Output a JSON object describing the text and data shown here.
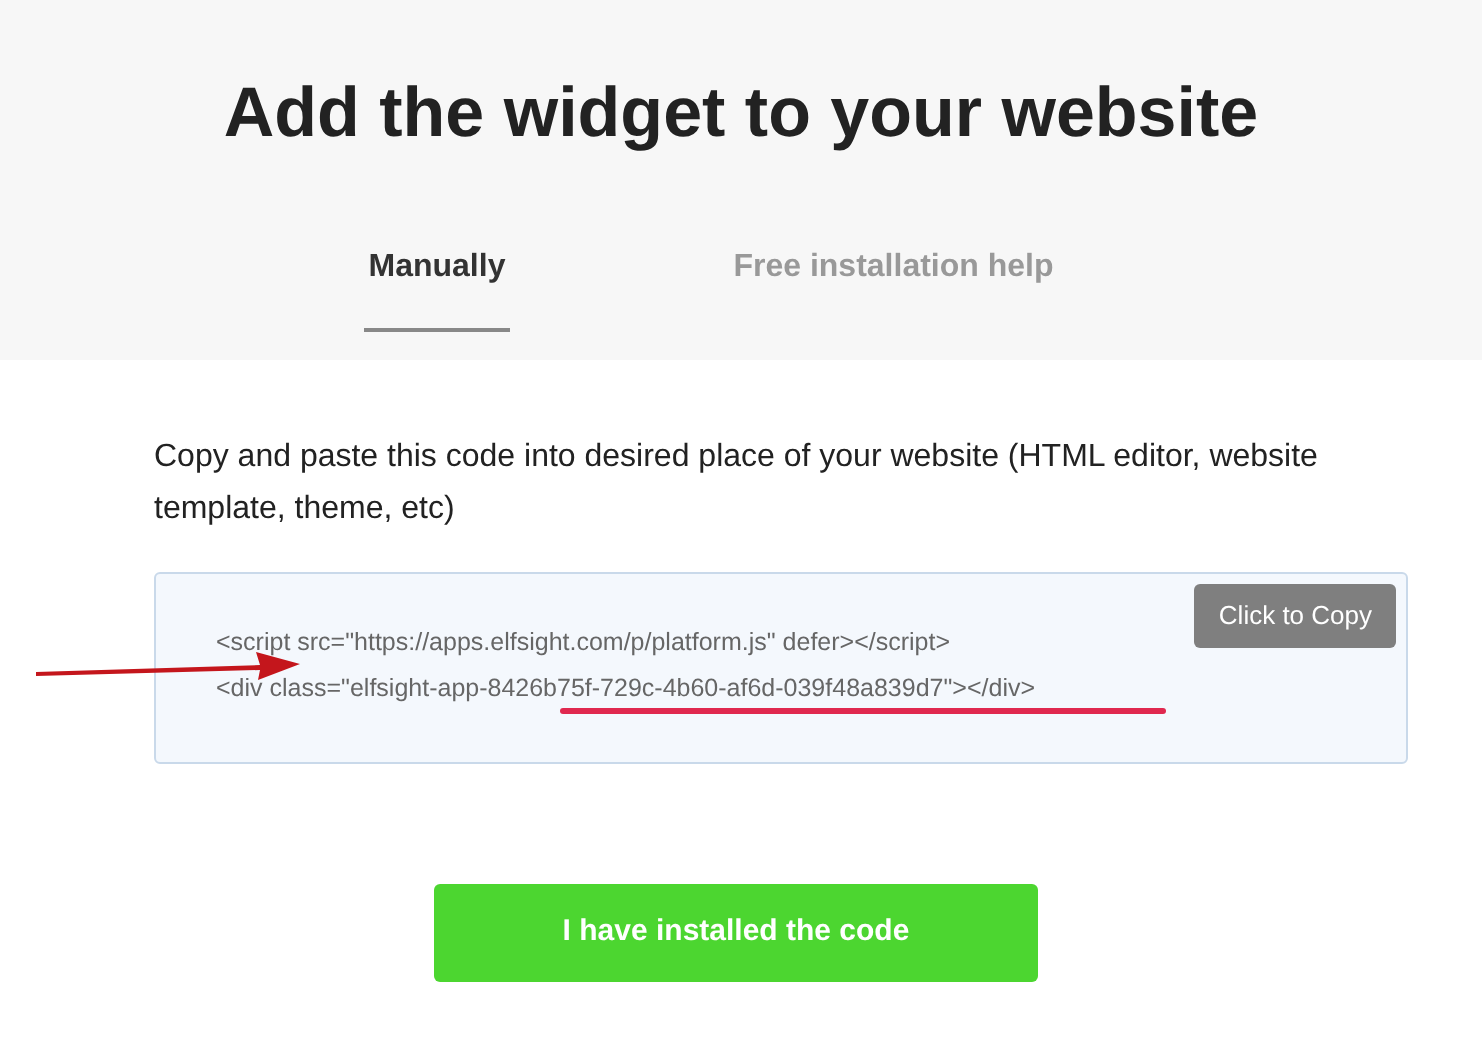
{
  "title": "Add the widget to your website",
  "tabs": [
    {
      "label": "Manually",
      "selected": true
    },
    {
      "label": "Free installation help",
      "selected": false
    }
  ],
  "instructions": "Copy and paste this code into desired place of your website (HTML editor, website template, theme, etc)",
  "code_lines": [
    "<script src=\"https://apps.elfsight.com/p/platform.js\" defer></script>",
    "<div class=\"elfsight-app-8426b75f-729c-4b60-af6d-039f48a839d7\"></div>"
  ],
  "copy_button": "Click to Copy",
  "confirm_button": "I have installed the code"
}
